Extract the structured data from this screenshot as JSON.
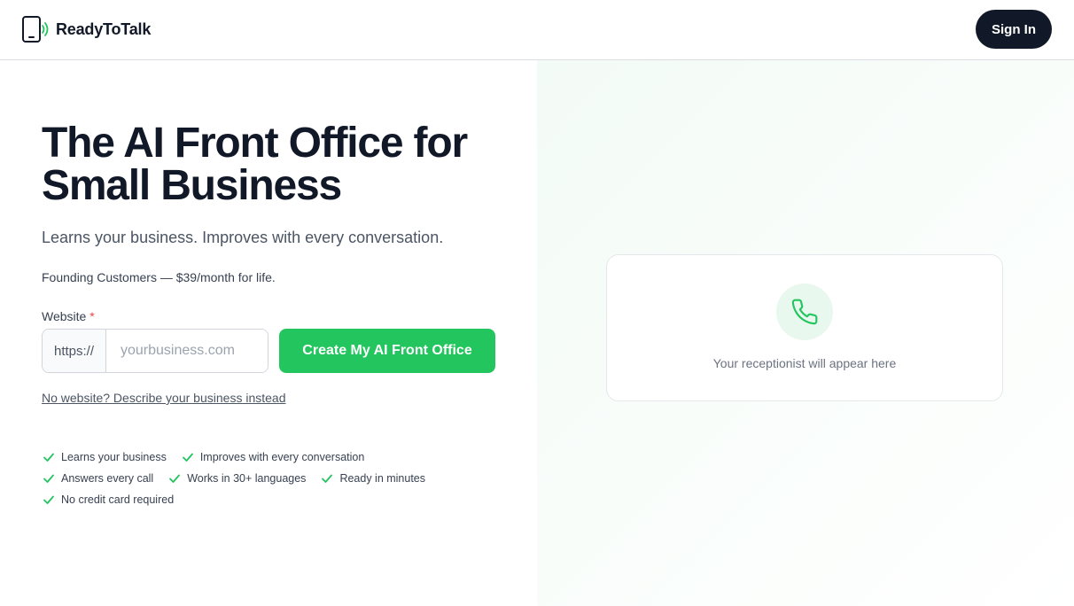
{
  "header": {
    "brand": "ReadyToTalk",
    "logo_icon": "phone-signal-icon",
    "signin_label": "Sign In"
  },
  "hero": {
    "headline": "The AI Front Office for Small Business",
    "subhead": "Learns your business. Improves with every conversation.",
    "offer": "Founding Customers — $39/month for life."
  },
  "form": {
    "label": "Website",
    "required_mark": "*",
    "prefix": "https://",
    "placeholder": "yourbusiness.com",
    "value": "",
    "cta_label": "Create My AI Front Office",
    "alt_link": "No website? Describe your business instead"
  },
  "features": [
    "Learns your business",
    "Improves with every conversation",
    "Answers every call",
    "Works in 30+ languages",
    "Ready in minutes",
    "No credit card required"
  ],
  "preview": {
    "icon": "phone-icon",
    "text": "Your receptionist will appear here"
  },
  "colors": {
    "accent": "#22c55e",
    "dark": "#111827"
  }
}
